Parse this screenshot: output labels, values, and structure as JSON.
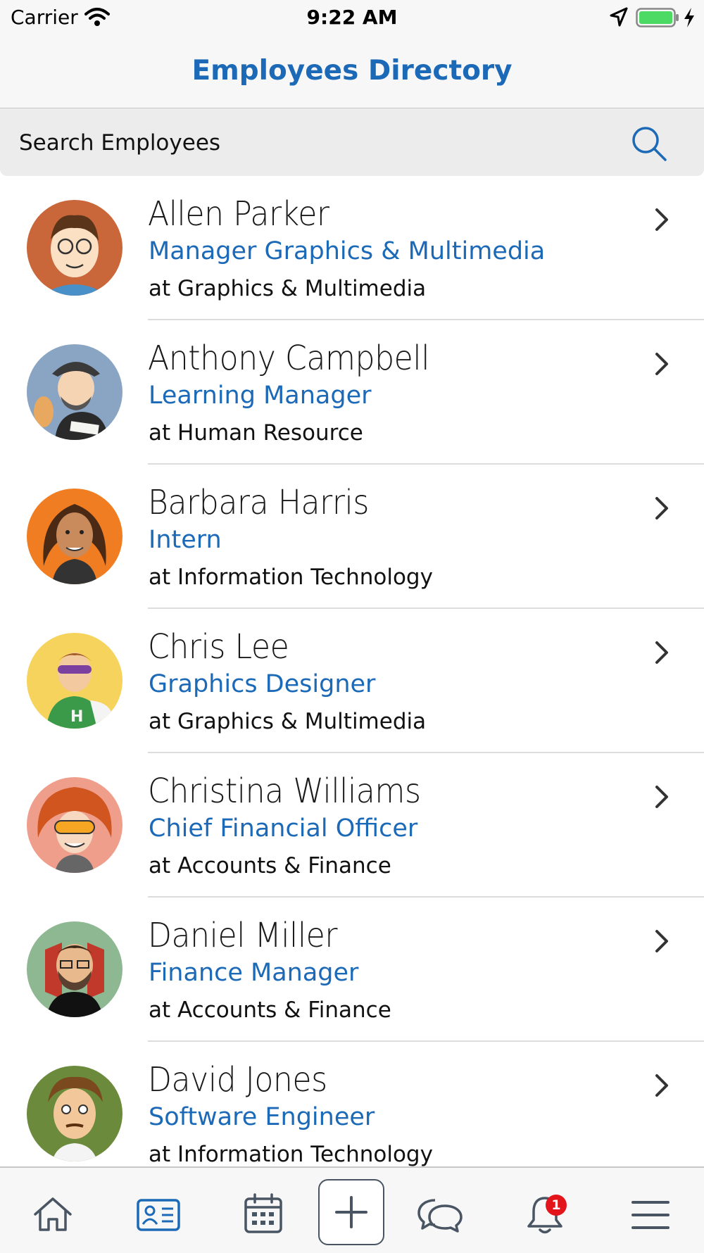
{
  "status_bar": {
    "carrier": "Carrier",
    "time": "9:22 AM",
    "battery_color": "#4cd964"
  },
  "nav": {
    "title": "Employees Directory"
  },
  "search": {
    "placeholder": "Search Employees",
    "icon": "search-icon"
  },
  "employees": [
    {
      "name": "Allen Parker",
      "role": "Manager Graphics & Multimedia",
      "dept": "at Graphics & Multimedia",
      "avatar_bg": "#c9663a"
    },
    {
      "name": "Anthony Campbell",
      "role": "Learning Manager",
      "dept": "at Human Resource",
      "avatar_bg": "#8aa4c4"
    },
    {
      "name": "Barbara Harris",
      "role": "Intern",
      "dept": "at Information Technology",
      "avatar_bg": "#f07d22"
    },
    {
      "name": "Chris Lee",
      "role": "Graphics Designer",
      "dept": "at Graphics & Multimedia",
      "avatar_bg": "#f5d35c"
    },
    {
      "name": "Christina Williams",
      "role": "Chief Financial Officer",
      "dept": "at Accounts & Finance",
      "avatar_bg": "#ef9e8c"
    },
    {
      "name": "Daniel Miller",
      "role": "Finance Manager",
      "dept": "at Accounts & Finance",
      "avatar_bg": "#8eb892"
    },
    {
      "name": "David Jones",
      "role": "Software Engineer",
      "dept": "at Information Technology",
      "avatar_bg": "#6b8a3c"
    }
  ],
  "tab_bar": {
    "tabs": [
      "home-icon",
      "contact-card-icon",
      "calendar-icon",
      "add-icon",
      "chat-icon",
      "bell-icon",
      "menu-icon"
    ],
    "active_tab": "contact-card-icon",
    "notification_count": "1"
  },
  "colors": {
    "accent": "#1c6ab7",
    "tab_icon": "#4a5563",
    "badge": "#e3151a"
  }
}
